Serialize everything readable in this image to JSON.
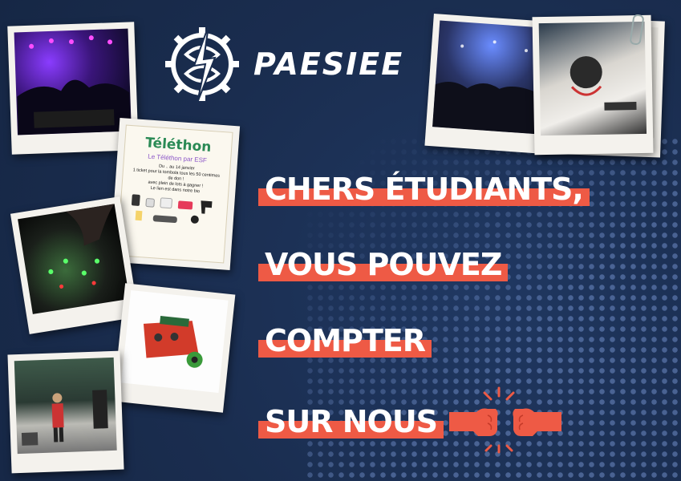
{
  "brand": {
    "name": "ESIEE",
    "prefix": "PA"
  },
  "headline": {
    "line1": "CHERS ÉTUDIANTS,",
    "line2": "VOUS POUVEZ",
    "line3": "COMPTER",
    "line4": "SUR NOUS"
  },
  "telethon": {
    "title": "Téléthon",
    "subtitle": "Le Téléthon par ESF",
    "dates": "Du .. au 14 janvier",
    "body1": "1 ticket pour la tombola tous les 50 centimes de don !",
    "body2": "avec plein de lots à gagner !",
    "body3": "Le lien est dans notre bio"
  },
  "colors": {
    "background": "#1a2d4f",
    "accent": "#ee5a45",
    "text": "#ffffff"
  },
  "icons": [
    "gear-bolt-logo-icon",
    "fist-bump-icon"
  ]
}
